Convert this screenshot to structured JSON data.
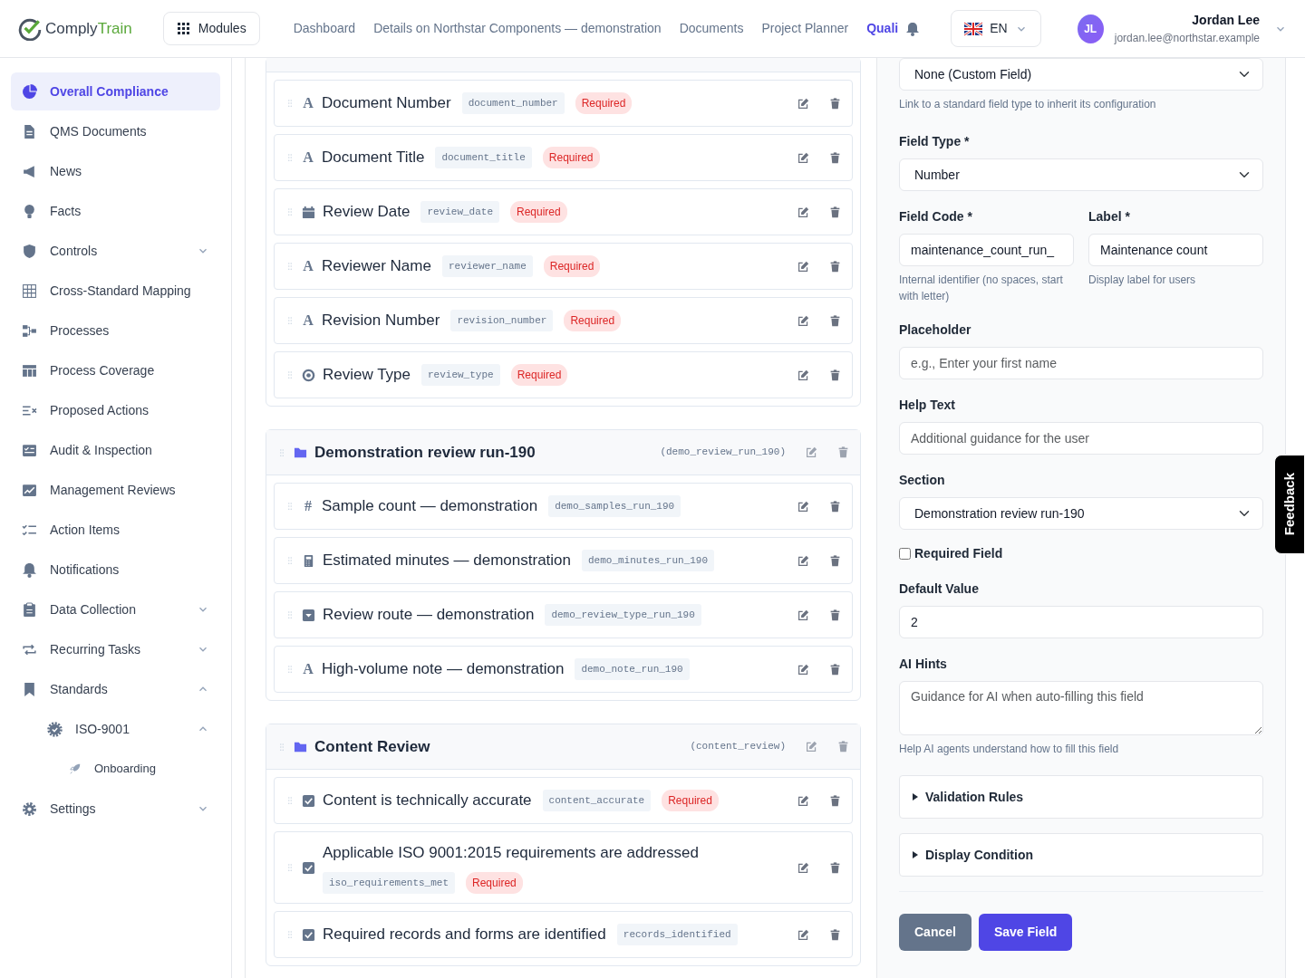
{
  "header": {
    "logo": {
      "part_1": "Comply",
      "part_2": "Train"
    },
    "modules_button": "Modules",
    "nav": [
      {
        "label": "Dashboard",
        "selected": false
      },
      {
        "label": "Details on Northstar Components — demonstration",
        "selected": false
      },
      {
        "label": "Documents",
        "selected": false
      },
      {
        "label": "Project Planner",
        "selected": false
      },
      {
        "label": "Quali",
        "selected": true
      }
    ],
    "language": "EN",
    "user": {
      "initials": "JL",
      "name": "Jordan Lee",
      "email": "jordan.lee@northstar.example"
    }
  },
  "sidebar": {
    "items": [
      {
        "label": "Overall Compliance",
        "selected": true
      },
      {
        "label": "QMS Documents",
        "selected": false
      },
      {
        "label": "News",
        "selected": false
      },
      {
        "label": "Facts",
        "selected": false
      },
      {
        "label": "Controls",
        "selected": false,
        "expanded": false
      },
      {
        "label": "Cross-Standard Mapping",
        "selected": false
      },
      {
        "label": "Processes",
        "selected": false
      },
      {
        "label": "Process Coverage",
        "selected": false
      },
      {
        "label": "Proposed Actions",
        "selected": false
      },
      {
        "label": "Audit & Inspection",
        "selected": false
      },
      {
        "label": "Management Reviews",
        "selected": false
      },
      {
        "label": "Action Items",
        "selected": false
      },
      {
        "label": "Notifications",
        "selected": false
      },
      {
        "label": "Data Collection",
        "selected": false,
        "expanded": false
      },
      {
        "label": "Recurring Tasks",
        "selected": false,
        "expanded": false
      },
      {
        "label": "Standards",
        "selected": false,
        "expanded": true,
        "children": [
          {
            "label": "ISO-9001",
            "selected": false,
            "expanded": true,
            "children": [
              {
                "label": "Onboarding",
                "selected": false
              }
            ]
          }
        ]
      },
      {
        "label": "Settings",
        "selected": false,
        "expanded": false
      }
    ]
  },
  "sections": [
    {
      "fields": [
        {
          "kind": "text",
          "glyph": "A",
          "title": "Document Number",
          "code": "document_number",
          "badge": "Required"
        },
        {
          "kind": "text",
          "glyph": "A",
          "title": "Document Title",
          "code": "document_title",
          "badge": "Required"
        },
        {
          "kind": "date",
          "title": "Review Date",
          "code": "review_date",
          "badge": "Required"
        },
        {
          "kind": "text",
          "glyph": "A",
          "title": "Reviewer Name",
          "code": "reviewer_name",
          "badge": "Required"
        },
        {
          "kind": "text",
          "glyph": "A",
          "title": "Revision Number",
          "code": "revision_number",
          "badge": "Required"
        },
        {
          "kind": "radio",
          "title": "Review Type",
          "code": "review_type",
          "badge": "Required"
        }
      ]
    },
    {
      "title": "Demonstration review run-190",
      "code": "(demo_review_run_190)",
      "fields": [
        {
          "kind": "number",
          "glyph": "#",
          "title": "Sample count — demonstration",
          "code": "demo_samples_run_190"
        },
        {
          "kind": "calculated",
          "title": "Estimated minutes — demonstration",
          "code": "demo_minutes_run_190"
        },
        {
          "kind": "select",
          "title": "Review route — demonstration",
          "code": "demo_review_type_run_190"
        },
        {
          "kind": "text",
          "glyph": "A",
          "title": "High-volume note — demonstration",
          "code": "demo_note_run_190"
        }
      ]
    },
    {
      "title": "Content Review",
      "code": "(content_review)",
      "fields": [
        {
          "kind": "checkbox",
          "title": "Content is technically accurate",
          "code": "content_accurate",
          "badge": "Required"
        },
        {
          "kind": "checkbox",
          "title": "Applicable ISO 9001:2015 requirements are addressed",
          "code": "iso_requirements_met",
          "badge": "Required"
        },
        {
          "kind": "checkbox",
          "title": "Required records and forms are identified",
          "code": "records_identified"
        }
      ]
    }
  ],
  "form": {
    "standard_select": {
      "value": "None (Custom Field)",
      "help": "Link to a standard field type to inherit its configuration"
    },
    "field_type": {
      "label": "Field Type *",
      "value": "Number"
    },
    "field_code": {
      "label": "Field Code *",
      "value": "maintenance_count_run_",
      "help": "Internal identifier (no spaces, start with letter)"
    },
    "label_field": {
      "label": "Label *",
      "value": "Maintenance count",
      "help": "Display label for users"
    },
    "placeholder_field": {
      "label": "Placeholder",
      "placeholder": "e.g., Enter your first name"
    },
    "help_text_field": {
      "label": "Help Text",
      "placeholder": "Additional guidance for the user"
    },
    "section_select": {
      "label": "Section",
      "value": "Demonstration review run-190"
    },
    "required_field": {
      "label": "Required Field",
      "checked": false
    },
    "default_value": {
      "label": "Default Value",
      "value": "2"
    },
    "ai_hints": {
      "label": "AI Hints",
      "placeholder": "Guidance for AI when auto-filling this field",
      "help": "Help AI agents understand how to fill this field"
    },
    "collapsibles": [
      {
        "label": "Validation Rules",
        "expanded": false
      },
      {
        "label": "Display Condition",
        "expanded": false
      }
    ],
    "buttons": [
      {
        "label": "Cancel",
        "kind": "secondary"
      },
      {
        "label": "Save Field",
        "kind": "primary"
      }
    ]
  },
  "feedback_tab": "Feedback"
}
